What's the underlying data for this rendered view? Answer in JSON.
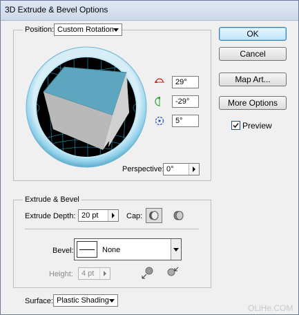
{
  "window": {
    "title": "3D Extrude & Bevel Options"
  },
  "position": {
    "label": "Position:",
    "selected": "Custom Rotation",
    "rot_x": "29°",
    "rot_y": "-29°",
    "rot_z": "5°",
    "perspective_label": "Perspective:",
    "perspective_value": "0°"
  },
  "buttons": {
    "ok": "OK",
    "cancel": "Cancel",
    "map_art": "Map Art...",
    "more_options": "More Options",
    "preview_label": "Preview"
  },
  "extrude": {
    "legend": "Extrude & Bevel",
    "depth_label": "Extrude Depth:",
    "depth_value": "20 pt",
    "cap_label": "Cap:",
    "bevel_label": "Bevel:",
    "bevel_value": "None",
    "height_label": "Height:",
    "height_value": "4 pt"
  },
  "surface": {
    "label": "Surface:",
    "selected": "Plastic Shading"
  },
  "watermark": "OLiHe.COM"
}
